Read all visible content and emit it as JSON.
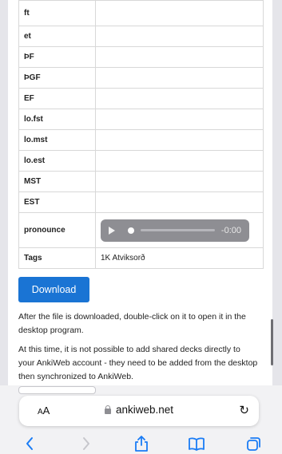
{
  "table": {
    "rows": [
      {
        "name": "ft",
        "value": ""
      },
      {
        "name": "et",
        "value": ""
      },
      {
        "name": "ÞF",
        "value": ""
      },
      {
        "name": "ÞGF",
        "value": ""
      },
      {
        "name": "EF",
        "value": ""
      },
      {
        "name": "lo.fst",
        "value": ""
      },
      {
        "name": "lo.mst",
        "value": ""
      },
      {
        "name": "lo.est",
        "value": ""
      },
      {
        "name": "MST",
        "value": ""
      },
      {
        "name": "EST",
        "value": ""
      }
    ],
    "pronounce": {
      "name": "pronounce",
      "time": "-0:00"
    },
    "tags": {
      "name": "Tags",
      "value": "1K Atviksorð"
    }
  },
  "download_label": "Download",
  "info": {
    "p1": "After the file is downloaded, double-click on it to open it in the desktop program.",
    "p2": "At this time, it is not possible to add shared decks directly to your AnkiWeb account - they need to be added from the desktop then synchronized to AnkiWeb."
  },
  "browser": {
    "text_size_label_small": "A",
    "text_size_label_large": "A",
    "url": "ankiweb.net"
  },
  "icons": {
    "lock": "lock-icon",
    "reload": "reload-icon",
    "back": "chevron-left-icon",
    "forward": "chevron-right-icon",
    "share": "share-icon",
    "bookmarks": "book-icon",
    "tabs": "tabs-icon",
    "play": "play-icon"
  },
  "colors": {
    "accent": "#1a74d4",
    "toolbar_icon": "#1a7cf5"
  }
}
